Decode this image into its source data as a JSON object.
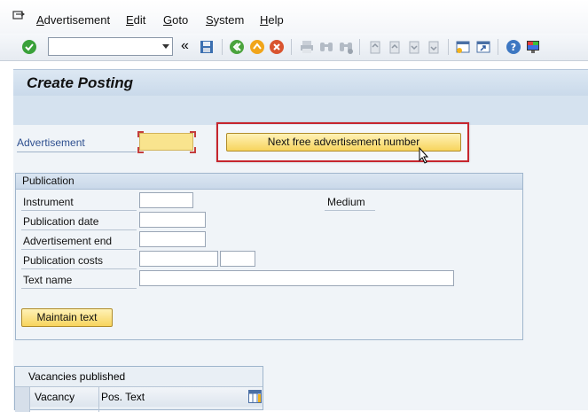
{
  "menu": {
    "items": [
      {
        "label": "Advertisement",
        "key": "A"
      },
      {
        "label": "Edit",
        "key": "E"
      },
      {
        "label": "Goto",
        "key": "G"
      },
      {
        "label": "System",
        "key": "S"
      },
      {
        "label": "Help",
        "key": "H"
      }
    ]
  },
  "toolbar": {
    "command_value": "",
    "history_glyph": "«"
  },
  "page": {
    "title": "Create Posting"
  },
  "header": {
    "advertisement_label": "Advertisement",
    "advertisement_value": "",
    "next_number_button": "Next free advertisement number"
  },
  "publication": {
    "title": "Publication",
    "fields": {
      "instrument": {
        "label": "Instrument",
        "value": ""
      },
      "medium": {
        "label": "Medium"
      },
      "publication_date": {
        "label": "Publication date",
        "value": ""
      },
      "advertisement_end": {
        "label": "Advertisement end",
        "value": ""
      },
      "publication_costs": {
        "label": "Publication costs",
        "value": "",
        "currency": ""
      },
      "text_name": {
        "label": "Text name",
        "value": ""
      }
    },
    "maintain_text_button": "Maintain text"
  },
  "vacancies_table": {
    "title": "Vacancies published",
    "columns": [
      "Vacancy",
      "Pos. Text"
    ]
  },
  "colors": {
    "title_bar": "#c9d9ea",
    "required_field": "#f9e48e",
    "highlight": "#c6262e",
    "button_yellow": "#f7d45d"
  }
}
